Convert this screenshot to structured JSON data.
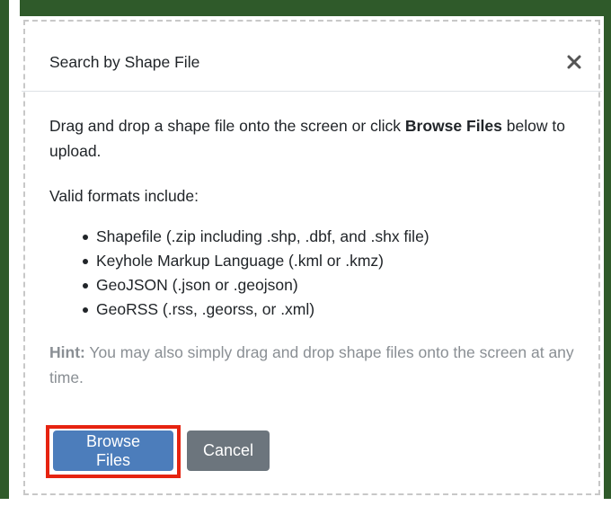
{
  "modal": {
    "title": "Search by Shape File",
    "close_icon": "close-x-icon",
    "intro_before": "Drag and drop a shape file onto the screen or click ",
    "intro_bold": "Browse Files",
    "intro_after": " below to upload.",
    "formats_heading": "Valid formats include:",
    "formats": [
      "Shapefile (.zip including .shp, .dbf, and .shx file)",
      "Keyhole Markup Language (.kml or .kmz)",
      "GeoJSON (.json or .geojson)",
      "GeoRSS (.rss, .georss, or .xml)"
    ],
    "hint_label": "Hint:",
    "hint_text": " You may also simply drag and drop shape files onto the screen at any time.",
    "browse_label": "Browse Files",
    "cancel_label": "Cancel"
  },
  "colors": {
    "browse_button": "#4c7dbb",
    "cancel_button": "#6c757d",
    "highlight_outline": "#e62310",
    "background": "#2f5a2a"
  }
}
